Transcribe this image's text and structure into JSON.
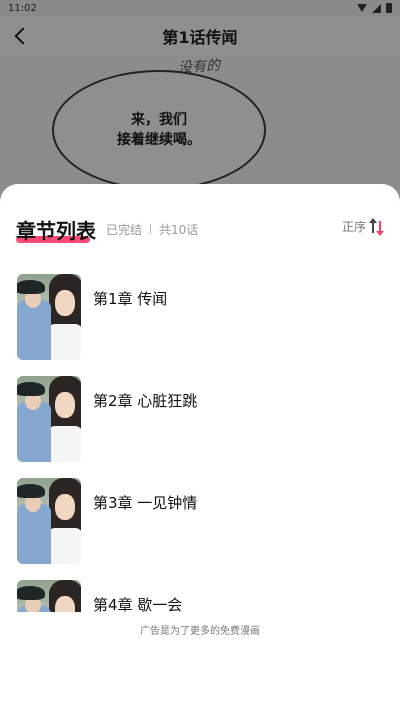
{
  "status_bar": {
    "time": "11:02",
    "icons": [
      "wifi-icon",
      "signal-icon",
      "battery-icon"
    ]
  },
  "top_bar": {
    "title": "第1话传闻",
    "back_icon": "chevron-left-icon"
  },
  "comic": {
    "scribble": "没有的",
    "bubble_lines": [
      "来，我们",
      "接着继续喝。"
    ]
  },
  "sheet": {
    "title": "章节列表",
    "status": "已完结",
    "count": "共10话",
    "sort_label": "正序",
    "sort_icon": "sort-icon",
    "accent": "#ff3f6f",
    "chapters": [
      {
        "title": "第1章 传闻"
      },
      {
        "title": "第2章 心脏狂跳"
      },
      {
        "title": "第3章 一见钟情"
      },
      {
        "title": "第4章 歇一会"
      }
    ],
    "ad_note": "广告是为了更多的免费漫画"
  }
}
